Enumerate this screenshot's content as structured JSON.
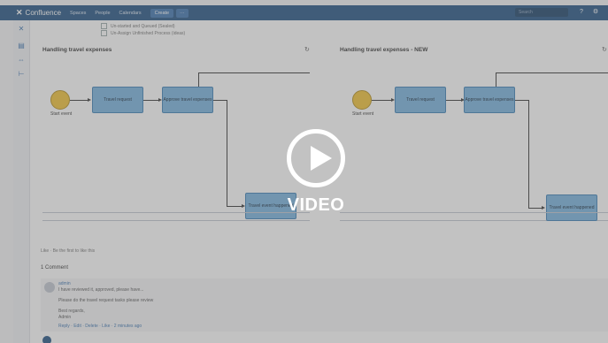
{
  "topnav": {
    "app_name": "Confluence",
    "items": [
      "Spaces",
      "People",
      "Calendars",
      "Create"
    ],
    "more_label": "···",
    "search_placeholder": "Search",
    "help_icon": "help-icon",
    "settings_icon": "gear-icon"
  },
  "sidebar": {
    "icons": [
      "confluence-logo-icon",
      "page-icon",
      "link-icon",
      "tree-icon"
    ]
  },
  "content": {
    "checklist": [
      "Un-started and Queued (Sealed)",
      "Un-Assign Unfinished Process (ideas)"
    ],
    "diagram_left": {
      "title": "Handling travel expenses",
      "start_label": "Start event",
      "tasks": [
        "Travel request",
        "Approve travel expenses",
        "Travel event happened"
      ]
    },
    "diagram_right": {
      "title": "Handling travel expenses - NEW",
      "start_label": "Start event",
      "tasks": [
        "Travel request",
        "Approve travel expenses",
        "Travel event happened"
      ]
    },
    "likes": "Like · Be the first to like this",
    "comments_header": "1 Comment",
    "comment": {
      "author": "admin",
      "line1": "I have reviewed it, approved, please have...",
      "line2": "Please do the travel request tasks please review",
      "line3": "Best regards,",
      "line4": "Admin",
      "links": "Reply · Edit · Delete · Like · 2 minutes ago"
    }
  },
  "overlay": {
    "video_label": "VIDEO",
    "play_icon": "play-icon"
  },
  "colors": {
    "nav_blue": "#205081",
    "task_fill": "#75b2de",
    "start_event": "#f1c232",
    "overlay": "#6e6e6e"
  }
}
